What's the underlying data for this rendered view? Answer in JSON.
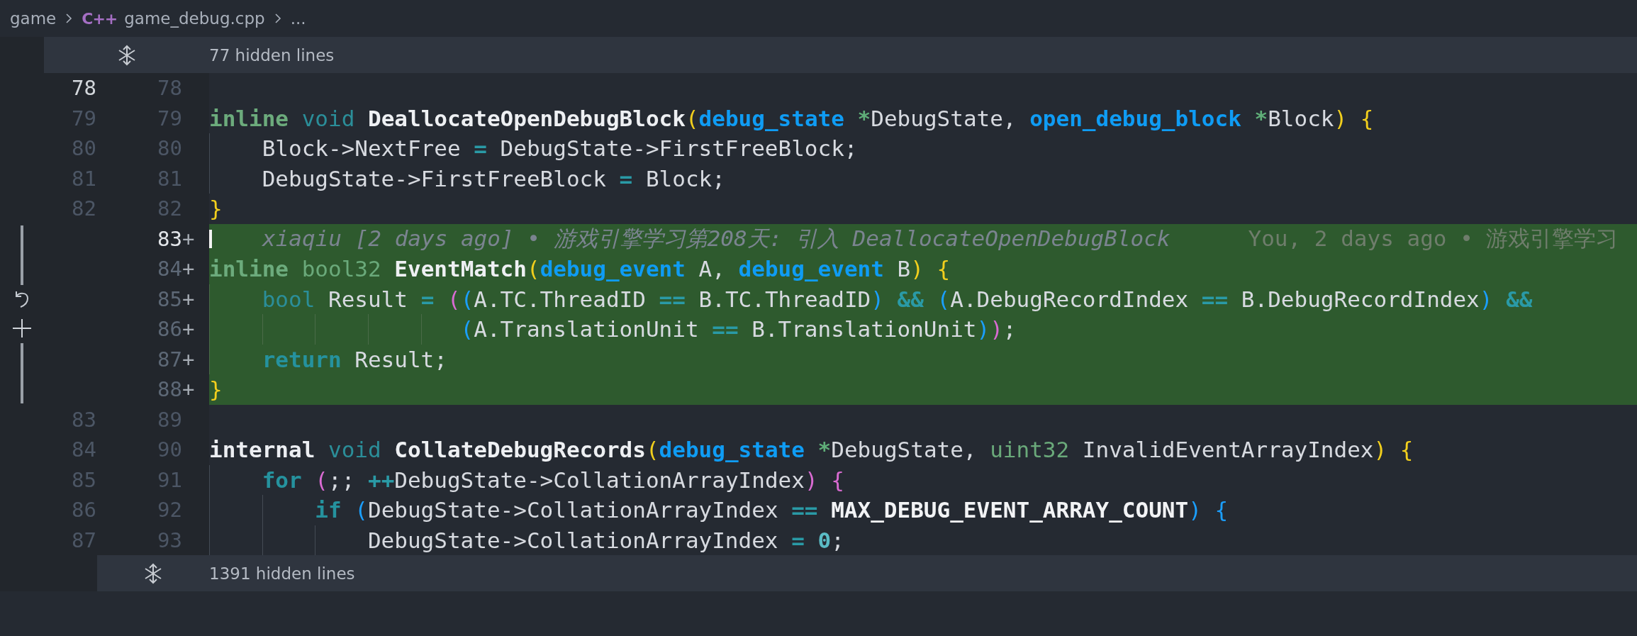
{
  "breadcrumb": {
    "items": [
      {
        "label": "game"
      },
      {
        "label": "game_debug.cpp",
        "icon": "C++"
      },
      {
        "label": "..."
      }
    ]
  },
  "hidden_regions": [
    {
      "label": "77 hidden lines"
    },
    {
      "label": "1391 hidden lines"
    }
  ],
  "lines": [
    {
      "old": "78",
      "new": "78",
      "old_active": true,
      "new_active": false,
      "added": false
    },
    {
      "old": "79",
      "new": "79",
      "old_active": false,
      "new_active": false,
      "added": false,
      "tokens": [
        {
          "text": "inline ",
          "kind": "kw"
        },
        {
          "text": "void ",
          "kind": "bt"
        },
        {
          "text": "DeallocateOpenDebugBlock",
          "kind": "fn"
        },
        {
          "text": "(",
          "kind": "by"
        },
        {
          "text": "debug_state ",
          "kind": "ty"
        },
        {
          "text": "*",
          "kind": "ptr"
        },
        {
          "text": "DebugState, ",
          "kind": "t"
        },
        {
          "text": "open_debug_block ",
          "kind": "ty"
        },
        {
          "text": "*",
          "kind": "ptr"
        },
        {
          "text": "Block",
          "kind": "t"
        },
        {
          "text": ") {",
          "kind": "by"
        }
      ]
    },
    {
      "old": "80",
      "new": "80",
      "old_active": false,
      "new_active": false,
      "added": false,
      "tokens": [
        {
          "text": "    Block->NextFree ",
          "kind": "t"
        },
        {
          "text": "= ",
          "kind": "op"
        },
        {
          "text": "DebugState->FirstFreeBlock;",
          "kind": "t"
        }
      ]
    },
    {
      "old": "81",
      "new": "81",
      "old_active": false,
      "new_active": false,
      "added": false,
      "tokens": [
        {
          "text": "    DebugState->FirstFreeBlock ",
          "kind": "t"
        },
        {
          "text": "= ",
          "kind": "op"
        },
        {
          "text": "Block;",
          "kind": "t"
        }
      ]
    },
    {
      "old": "82",
      "new": "82",
      "old_active": false,
      "new_active": false,
      "added": false,
      "tokens": [
        {
          "text": "}",
          "kind": "by"
        }
      ]
    },
    {
      "new": "83",
      "new_active": true,
      "added": true,
      "sign": "+",
      "blame": "xiaqiu [2 days ago] • 游戏引擎学习第208天: 引入 DeallocateOpenDebugBlock",
      "current_blame": "You, 2 days ago • 游戏引擎学习"
    },
    {
      "new": "84",
      "new_active": false,
      "added": true,
      "sign": "+",
      "tokens": [
        {
          "text": "inline ",
          "kind": "kw"
        },
        {
          "text": "bool32 ",
          "kind": "ut"
        },
        {
          "text": "EventMatch",
          "kind": "fn"
        },
        {
          "text": "(",
          "kind": "by"
        },
        {
          "text": "debug_event ",
          "kind": "ty"
        },
        {
          "text": "A, ",
          "kind": "t"
        },
        {
          "text": "debug_event ",
          "kind": "ty"
        },
        {
          "text": "B",
          "kind": "t"
        },
        {
          "text": ") {",
          "kind": "by"
        }
      ]
    },
    {
      "new": "85",
      "new_active": false,
      "added": true,
      "sign": "+",
      "tokens": [
        {
          "text": "    bool ",
          "kind": "bt"
        },
        {
          "text": "Result ",
          "kind": "t"
        },
        {
          "text": "= ",
          "kind": "op"
        },
        {
          "text": "(",
          "kind": "bp"
        },
        {
          "text": "(",
          "kind": "bb"
        },
        {
          "text": "A.TC.ThreadID ",
          "kind": "t"
        },
        {
          "text": "== ",
          "kind": "op"
        },
        {
          "text": "B.TC.ThreadID",
          "kind": "t"
        },
        {
          "text": ") ",
          "kind": "bb"
        },
        {
          "text": "&& ",
          "kind": "op"
        },
        {
          "text": "(",
          "kind": "bb"
        },
        {
          "text": "A.DebugRecordIndex ",
          "kind": "t"
        },
        {
          "text": "== ",
          "kind": "op"
        },
        {
          "text": "B.DebugRecordIndex",
          "kind": "t"
        },
        {
          "text": ") ",
          "kind": "bb"
        },
        {
          "text": "&&",
          "kind": "op"
        }
      ]
    },
    {
      "new": "86",
      "new_active": false,
      "added": true,
      "sign": "+",
      "tokens": [
        {
          "text": "                   (",
          "kind": "bb"
        },
        {
          "text": "A.TranslationUnit ",
          "kind": "t"
        },
        {
          "text": "== ",
          "kind": "op"
        },
        {
          "text": "B.TranslationUnit",
          "kind": "t"
        },
        {
          "text": ")",
          "kind": "bb"
        },
        {
          "text": ")",
          "kind": "bp"
        },
        {
          "text": ";",
          "kind": "t"
        }
      ]
    },
    {
      "new": "87",
      "new_active": false,
      "added": true,
      "sign": "+",
      "tokens": [
        {
          "text": "    return ",
          "kind": "ctl"
        },
        {
          "text": "Result;",
          "kind": "t"
        }
      ]
    },
    {
      "new": "88",
      "new_active": false,
      "added": true,
      "sign": "+",
      "tokens": [
        {
          "text": "}",
          "kind": "by"
        }
      ]
    },
    {
      "old": "83",
      "new": "89",
      "old_active": false,
      "new_active": false,
      "added": false
    },
    {
      "old": "84",
      "new": "90",
      "old_active": false,
      "new_active": false,
      "added": false,
      "tokens": [
        {
          "text": "internal ",
          "kind": "st"
        },
        {
          "text": "void ",
          "kind": "bt"
        },
        {
          "text": "CollateDebugRecords",
          "kind": "fn"
        },
        {
          "text": "(",
          "kind": "by"
        },
        {
          "text": "debug_state ",
          "kind": "ty"
        },
        {
          "text": "*",
          "kind": "ptr"
        },
        {
          "text": "DebugState, ",
          "kind": "t"
        },
        {
          "text": "uint32 ",
          "kind": "ut"
        },
        {
          "text": "InvalidEventArrayIndex",
          "kind": "t"
        },
        {
          "text": ") {",
          "kind": "by"
        }
      ]
    },
    {
      "old": "85",
      "new": "91",
      "old_active": false,
      "new_active": false,
      "added": false,
      "tokens": [
        {
          "text": "    for ",
          "kind": "ctl"
        },
        {
          "text": "(",
          "kind": "bp"
        },
        {
          "text": ";; ",
          "kind": "t"
        },
        {
          "text": "++",
          "kind": "op"
        },
        {
          "text": "DebugState->CollationArrayIndex",
          "kind": "t"
        },
        {
          "text": ") {",
          "kind": "bp"
        }
      ]
    },
    {
      "old": "86",
      "new": "92",
      "old_active": false,
      "new_active": false,
      "added": false,
      "tokens": [
        {
          "text": "        if ",
          "kind": "ctl"
        },
        {
          "text": "(",
          "kind": "bb"
        },
        {
          "text": "DebugState->CollationArrayIndex ",
          "kind": "t"
        },
        {
          "text": "== ",
          "kind": "op"
        },
        {
          "text": "MAX_DEBUG_EVENT_ARRAY_COUNT",
          "kind": "cst"
        },
        {
          "text": ") {",
          "kind": "bb"
        }
      ]
    },
    {
      "old": "87",
      "new": "93",
      "old_active": false,
      "new_active": false,
      "added": false,
      "tokens": [
        {
          "text": "            DebugState->CollationArrayIndex ",
          "kind": "t"
        },
        {
          "text": "= ",
          "kind": "op"
        },
        {
          "text": "0",
          "kind": "num"
        },
        {
          "text": ";",
          "kind": "t"
        }
      ]
    }
  ]
}
